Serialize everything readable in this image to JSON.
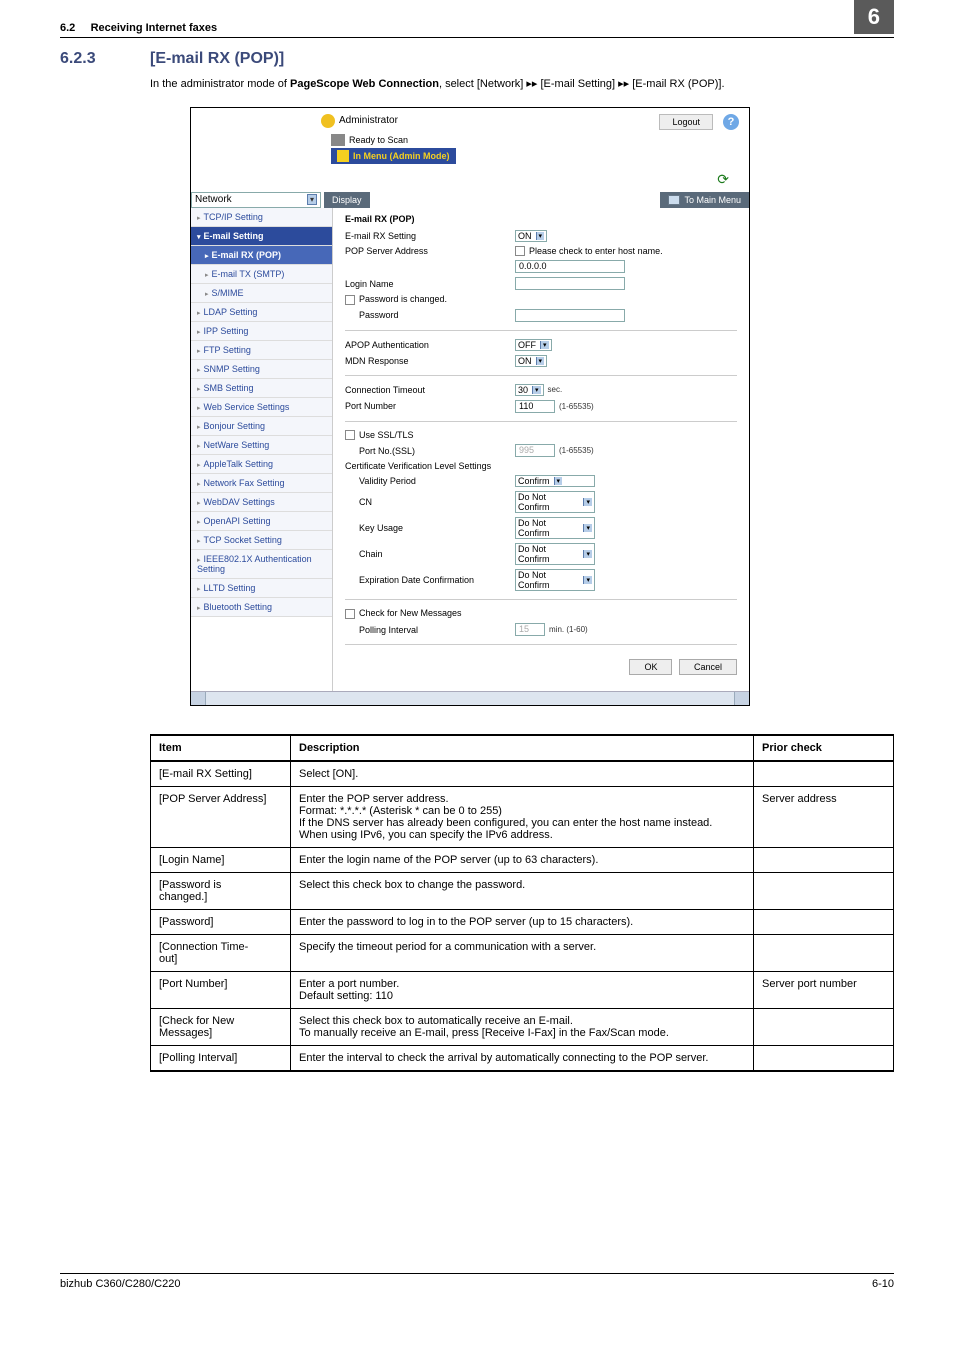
{
  "header": {
    "num": "6.2",
    "title": "Receiving Internet faxes",
    "chapter": "6"
  },
  "section": {
    "num": "6.2.3",
    "title": "[E-mail RX (POP)]"
  },
  "intro": {
    "p1": "In the administrator mode of ",
    "bold": "PageScope Web Connection",
    "p2": ", select [Network] ",
    "arrow": "▸▸",
    "p3": " [E-mail Setting] ",
    "p4": " [E-mail RX (POP)]."
  },
  "shot": {
    "admin": "Administrator",
    "ready": "Ready to Scan",
    "mode": "In Menu (Admin Mode)",
    "logout": "Logout",
    "help": "?",
    "category": "Network",
    "display_btn": "Display",
    "mainmenu": "To Main Menu",
    "pane_title": "E-mail RX (POP)",
    "side": [
      "TCP/IP Setting",
      "E-mail Setting",
      "E-mail RX (POP)",
      "E-mail TX (SMTP)",
      "S/MIME",
      "LDAP Setting",
      "IPP Setting",
      "FTP Setting",
      "SNMP Setting",
      "SMB Setting",
      "Web Service Settings",
      "Bonjour Setting",
      "NetWare Setting",
      "AppleTalk Setting",
      "Network Fax Setting",
      "WebDAV Settings",
      "OpenAPI Setting",
      "TCP Socket Setting",
      "IEEE802.1X Authentication Setting",
      "LLTD Setting",
      "Bluetooth Setting"
    ],
    "form": {
      "rx": {
        "lbl": "E-mail RX Setting",
        "val": "ON"
      },
      "pop": {
        "lbl": "POP Server Address",
        "chk": "Please check to enter host name.",
        "val": "0.0.0.0"
      },
      "login": {
        "lbl": "Login Name"
      },
      "pwchg": {
        "lbl": "Password is changed."
      },
      "pw": {
        "lbl": "Password"
      },
      "apop": {
        "lbl": "APOP Authentication",
        "val": "OFF"
      },
      "mdn": {
        "lbl": "MDN Response",
        "val": "ON"
      },
      "timeout": {
        "lbl": "Connection Timeout",
        "val": "30",
        "unit": "sec."
      },
      "port": {
        "lbl": "Port Number",
        "val": "110",
        "range": "(1-65535)"
      },
      "ssl": {
        "lbl": "Use SSL/TLS"
      },
      "sslport": {
        "lbl": "Port No.(SSL)",
        "val": "995",
        "range": "(1-65535)"
      },
      "cert": {
        "lbl": "Certificate Verification Level Settings"
      },
      "valid": {
        "lbl": "Validity Period",
        "val": "Confirm"
      },
      "cn": {
        "lbl": "CN",
        "val": "Do Not Confirm"
      },
      "key": {
        "lbl": "Key Usage",
        "val": "Do Not Confirm"
      },
      "chain": {
        "lbl": "Chain",
        "val": "Do Not Confirm"
      },
      "exp": {
        "lbl": "Expiration Date Confirmation",
        "val": "Do Not Confirm"
      },
      "chk": {
        "lbl": "Check for New Messages"
      },
      "poll": {
        "lbl": "Polling Interval",
        "val": "15",
        "unit": "min.  (1-60)"
      }
    },
    "ok": "OK",
    "cancel": "Cancel"
  },
  "table": {
    "head": [
      "Item",
      "Description",
      "Prior check"
    ],
    "rows": [
      {
        "item": "[E-mail RX Setting]",
        "desc": "Select [ON].",
        "prior": ""
      },
      {
        "item": "[POP Server Address]",
        "desc": "Enter the POP server address.\nFormat: *.*.*.* (Asterisk * can be 0 to 255)\nIf the DNS server has already been configured, you can enter the host name instead.\nWhen using IPv6, you can specify the IPv6 address.",
        "prior": "Server address"
      },
      {
        "item": "[Login Name]",
        "desc": "Enter the login name of the POP server (up to 63 characters).",
        "prior": ""
      },
      {
        "item": "[Password is\nchanged.]",
        "desc": "Select this check box to change the password.",
        "prior": ""
      },
      {
        "item": "[Password]",
        "desc": "Enter the password to log in to the POP server (up to 15 characters).",
        "prior": ""
      },
      {
        "item": "[Connection Time-\nout]",
        "desc": "Specify the timeout period for a communication with a server.",
        "prior": ""
      },
      {
        "item": "[Port Number]",
        "desc": "Enter a port number.\nDefault setting: 110",
        "prior": "Server port number"
      },
      {
        "item": "[Check for New\nMessages]",
        "desc": "Select this check box to automatically receive an E-mail.\nTo manually receive an E-mail, press [Receive I-Fax] in the Fax/Scan mode.",
        "prior": ""
      },
      {
        "item": "[Polling Interval]",
        "desc": "Enter the interval to check the arrival by automatically connecting to the POP server.",
        "prior": ""
      }
    ]
  },
  "footer": {
    "model": "bizhub C360/C280/C220",
    "page": "6-10"
  }
}
